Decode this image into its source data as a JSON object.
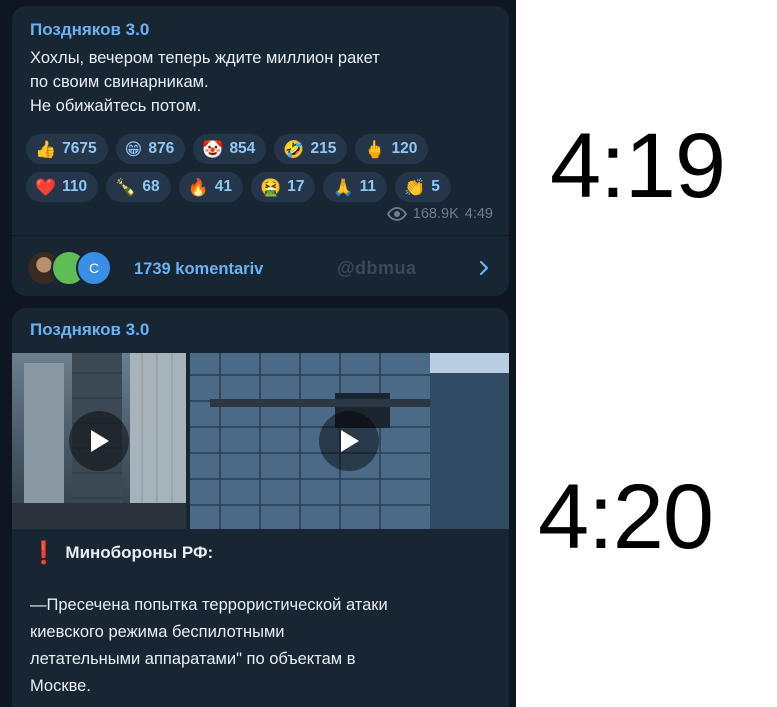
{
  "post1": {
    "author": "Поздняков 3.0",
    "text_lines": [
      "Хохлы, вечером теперь ждите миллион ракет",
      "по своим свинарникам.",
      "Не обижайтесь потом."
    ],
    "reactions": [
      {
        "emoji": "👍",
        "count": "7675"
      },
      {
        "emoji": "😁",
        "count": "876"
      },
      {
        "emoji": "🤡",
        "count": "854"
      },
      {
        "emoji": "🤣",
        "count": "215"
      },
      {
        "emoji": "🖕",
        "count": "120"
      },
      {
        "emoji": "❤️",
        "count": "110"
      },
      {
        "emoji": "🍾",
        "count": "68"
      },
      {
        "emoji": "🔥",
        "count": "41"
      },
      {
        "emoji": "🤮",
        "count": "17"
      },
      {
        "emoji": "🙏",
        "count": "11"
      },
      {
        "emoji": "👏",
        "count": "5"
      }
    ],
    "views": "168.9K",
    "time": "4:49",
    "avatar3_letter": "C",
    "comments_label": "1739 komentariv",
    "watermark": "@dbmua"
  },
  "post2": {
    "author": "Поздняков 3.0",
    "headline_icon": "❗",
    "headline": "Минобороны РФ:",
    "text_lines": [
      "—Пресечена попытка террористической атаки",
      "киевского режима беспилотными",
      "летательными аппаратами\" по объектам в",
      "Москве."
    ]
  },
  "captions": {
    "time_top": "4:19",
    "time_bottom": "4:20"
  },
  "colors": {
    "background": "#0e1621",
    "bubble": "#182533",
    "accent": "#6ab3f3",
    "reaction_bg": "#26364a"
  }
}
